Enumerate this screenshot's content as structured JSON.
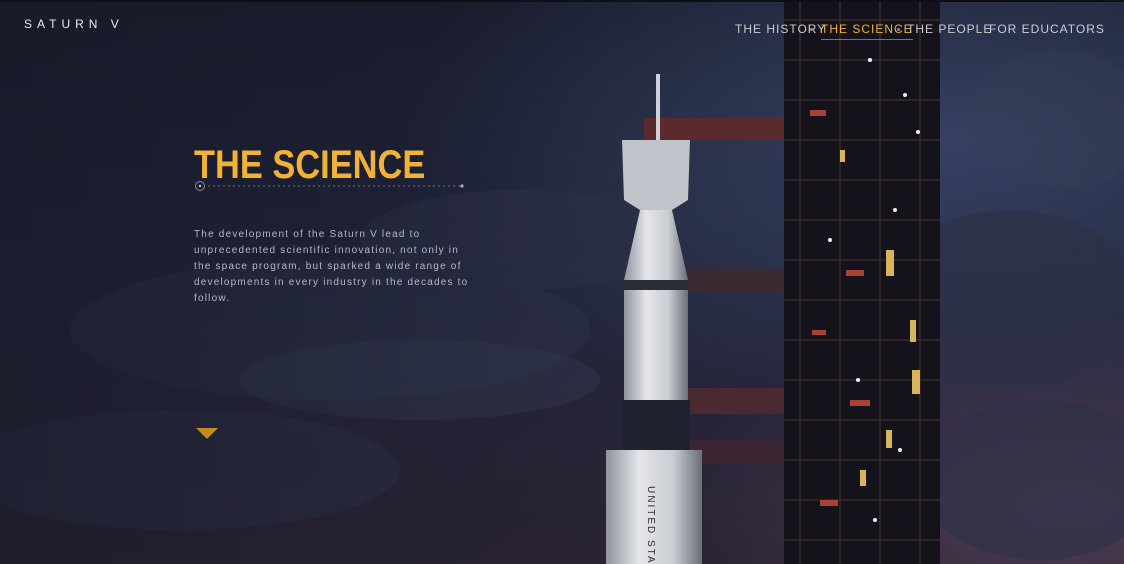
{
  "header": {
    "brand": "SATURN V",
    "nav": [
      {
        "label": "THE HISTORY",
        "active": false
      },
      {
        "label": "THE SCIENCE",
        "active": true
      },
      {
        "label": "THE PEOPLE",
        "active": false
      },
      {
        "label": "FOR EDUCATORS",
        "active": false
      }
    ]
  },
  "main": {
    "title": "THE SCIENCE",
    "intro": "The development of the Saturn V lead to unprecedented scientific innovation, not only in the space program, but sparked a wide range of developments in every industry in the decades to follow.",
    "scroll_icon": "chevron-down-icon"
  },
  "background": {
    "image": "rocket-on-launch-pad",
    "rocket_lettering": "UNITED STA"
  },
  "colors": {
    "accent": "#f2b234",
    "background": "#1c1f2e",
    "nav_text": "#c9cbd3",
    "body_text": "#b5b8c3"
  }
}
